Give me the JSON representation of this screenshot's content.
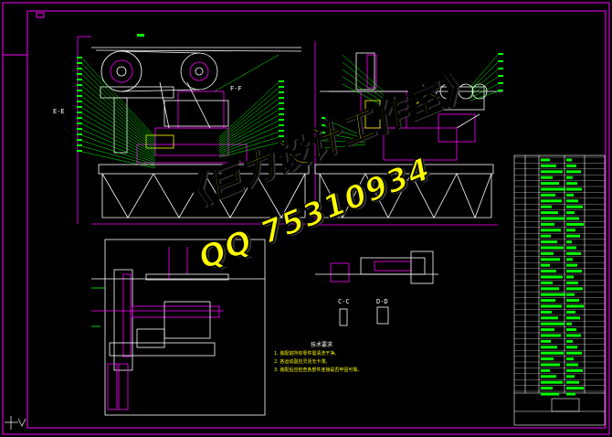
{
  "watermark": {
    "line1": "《巨力设计工作室》",
    "line2": "QQ 75310934"
  },
  "section_labels": {
    "e_e": "E-E",
    "f_f": "F-F",
    "c_c": "C-C",
    "d_d": "D-D"
  },
  "notes": {
    "title": "技术要求",
    "item1": "1. 装配前所有零件需清洗干净。",
    "item2": "2. 各运动副应灵活无卡滞。",
    "item3": "3. 装配后应检查各部件连接是否牢固可靠。"
  },
  "colors": {
    "background": "#000000",
    "frame": "#ff00ff",
    "linework": "#ffffff",
    "dimension": "#00ff00",
    "accent": "#ffff00",
    "hatch": "#ff00ff"
  }
}
